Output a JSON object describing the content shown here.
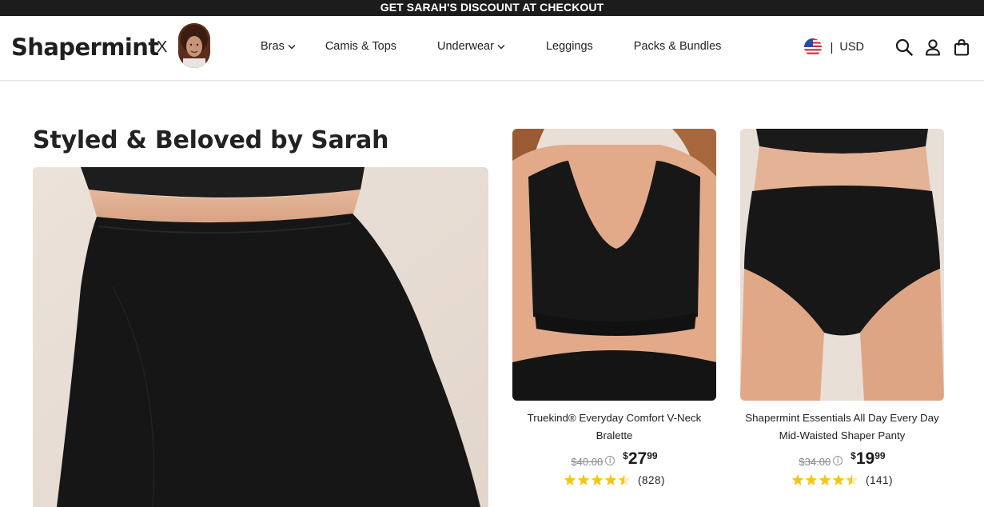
{
  "promo": {
    "text": "GET SARAH'S DISCOUNT AT CHECKOUT"
  },
  "header": {
    "logo": "Shapermint",
    "collab_separator": "X",
    "nav": [
      {
        "label": "Bras",
        "has_dropdown": true
      },
      {
        "label": "Camis & Tops",
        "has_dropdown": false
      },
      {
        "label": "Underwear",
        "has_dropdown": true
      },
      {
        "label": "Leggings",
        "has_dropdown": false
      },
      {
        "label": "Packs & Bundles",
        "has_dropdown": false
      }
    ],
    "divider": "|",
    "currency": "USD",
    "icons": [
      "us-flag-icon",
      "search-icon",
      "account-icon",
      "cart-icon"
    ]
  },
  "main": {
    "heading": "Styled & Beloved by Sarah",
    "products": [
      {
        "name": "Truekind® Everyday Comfort V-Neck Bralette",
        "original_price": "$40.00",
        "currency_symbol": "$",
        "price_whole": "27",
        "price_cents": "99",
        "rating": 4.5,
        "reviews": "(828)"
      },
      {
        "name": "Shapermint Essentials All Day Every Day Mid-Waisted Shaper Panty",
        "original_price": "$34.00",
        "currency_symbol": "$",
        "price_whole": "19",
        "price_cents": "99",
        "rating": 4.5,
        "reviews": "(141)"
      }
    ]
  },
  "colors": {
    "promo_bg": "#1c1c1c",
    "star": "#f5c518",
    "text": "#222222",
    "muted": "#8a8a8a"
  }
}
